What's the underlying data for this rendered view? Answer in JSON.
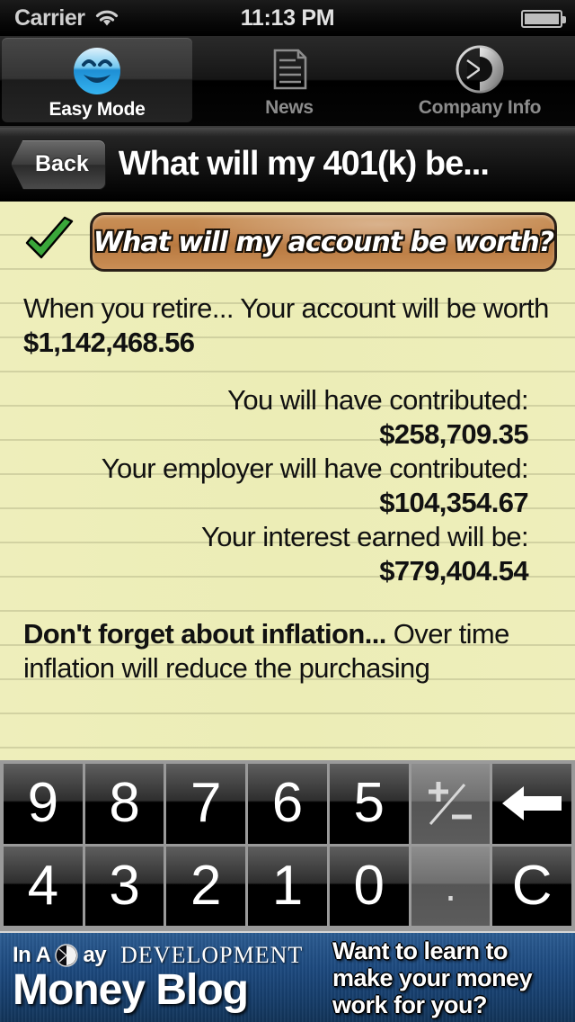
{
  "status_bar": {
    "carrier": "Carrier",
    "time": "11:13 PM",
    "wifi_icon": "wifi-icon",
    "battery_icon": "battery-full-icon"
  },
  "tab_bar": {
    "tabs": [
      {
        "label": "Easy Mode",
        "icon": "smiley-face-icon",
        "selected": true
      },
      {
        "label": "News",
        "icon": "document-page-icon",
        "selected": false
      },
      {
        "label": "Company Info",
        "icon": "in-a-day-logo-icon",
        "selected": false
      }
    ]
  },
  "nav_bar": {
    "back_label": "Back",
    "title": "What will my 401(k) be..."
  },
  "content": {
    "check_icon": "green-checkmark-icon",
    "banner_title": "What will my account be worth?",
    "lead_prefix": "When you retire... Your account will be worth ",
    "lead_value": "$1,142,468.56",
    "rows": [
      {
        "label": "You will have contributed:",
        "value": "$258,709.35"
      },
      {
        "label": "Your employer will have contributed:",
        "value": "$104,354.67"
      },
      {
        "label": "Your interest earned will be:",
        "value": "$779,404.54"
      }
    ],
    "inflation_heading": "Don't forget about inflation...",
    "inflation_body": " Over time inflation will reduce the purchasing"
  },
  "keypad": {
    "rows": [
      [
        {
          "label": "9",
          "name": "key-9",
          "style": "num"
        },
        {
          "label": "8",
          "name": "key-8",
          "style": "num"
        },
        {
          "label": "7",
          "name": "key-7",
          "style": "num"
        },
        {
          "label": "6",
          "name": "key-6",
          "style": "num"
        },
        {
          "label": "5",
          "name": "key-5",
          "style": "num"
        },
        {
          "label": "+/-",
          "name": "key-plus-minus",
          "style": "alt-sign"
        },
        {
          "label": "",
          "name": "key-backspace",
          "style": "backspace"
        }
      ],
      [
        {
          "label": "4",
          "name": "key-4",
          "style": "num"
        },
        {
          "label": "3",
          "name": "key-3",
          "style": "num"
        },
        {
          "label": "2",
          "name": "key-2",
          "style": "num"
        },
        {
          "label": "1",
          "name": "key-1",
          "style": "num"
        },
        {
          "label": "0",
          "name": "key-0",
          "style": "num"
        },
        {
          "label": ".",
          "name": "key-decimal",
          "style": "alt-dot"
        },
        {
          "label": "C",
          "name": "key-clear",
          "style": "num"
        }
      ]
    ]
  },
  "ad_banner": {
    "brand_in": "In A",
    "brand_ay": "ay",
    "brand_logo_icon": "in-a-day-logo-icon",
    "development": "DEVELOPMENT",
    "title": "Money Blog",
    "pitch_lines": [
      "Want to learn to",
      "make your money",
      "work for you?"
    ]
  },
  "colors": {
    "paper": "#eeeebb",
    "banner_brown": "#c08048",
    "checkmark_green": "#3aa73a",
    "ad_blue": "#1d4a80",
    "keypad_frame": "#9a9a9a"
  }
}
